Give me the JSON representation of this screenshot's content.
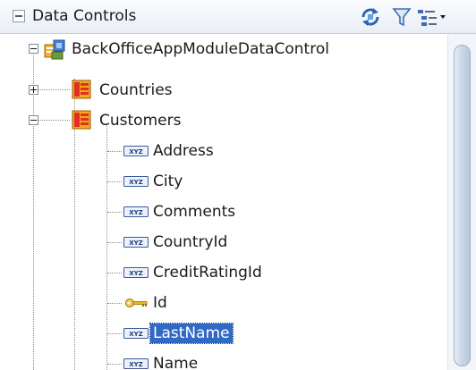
{
  "panel": {
    "title": "Data Controls",
    "toolbar": {
      "refresh_icon": "refresh-icon",
      "filter_icon": "filter-icon",
      "view_menu_icon": "view-options-icon"
    }
  },
  "tree": {
    "root": "BackOfficeAppModuleDataControl",
    "countries": "Countries",
    "customers": "Customers",
    "attributes": [
      {
        "label": "Address",
        "icon": "text-attribute-icon"
      },
      {
        "label": "City",
        "icon": "text-attribute-icon"
      },
      {
        "label": "Comments",
        "icon": "text-attribute-icon"
      },
      {
        "label": "CountryId",
        "icon": "text-attribute-icon"
      },
      {
        "label": "CreditRatingId",
        "icon": "text-attribute-icon"
      },
      {
        "label": "Id",
        "icon": "key-attribute-icon"
      },
      {
        "label": "LastName",
        "icon": "text-attribute-icon",
        "selected": true
      },
      {
        "label": "Name",
        "icon": "text-attribute-icon"
      }
    ]
  },
  "attribute_icon_text": "XYZ",
  "colors": {
    "selection": "#316ac5",
    "collection_red": "#e03020",
    "collection_orange": "#f7a81e",
    "key_yellow": "#e8b820"
  }
}
